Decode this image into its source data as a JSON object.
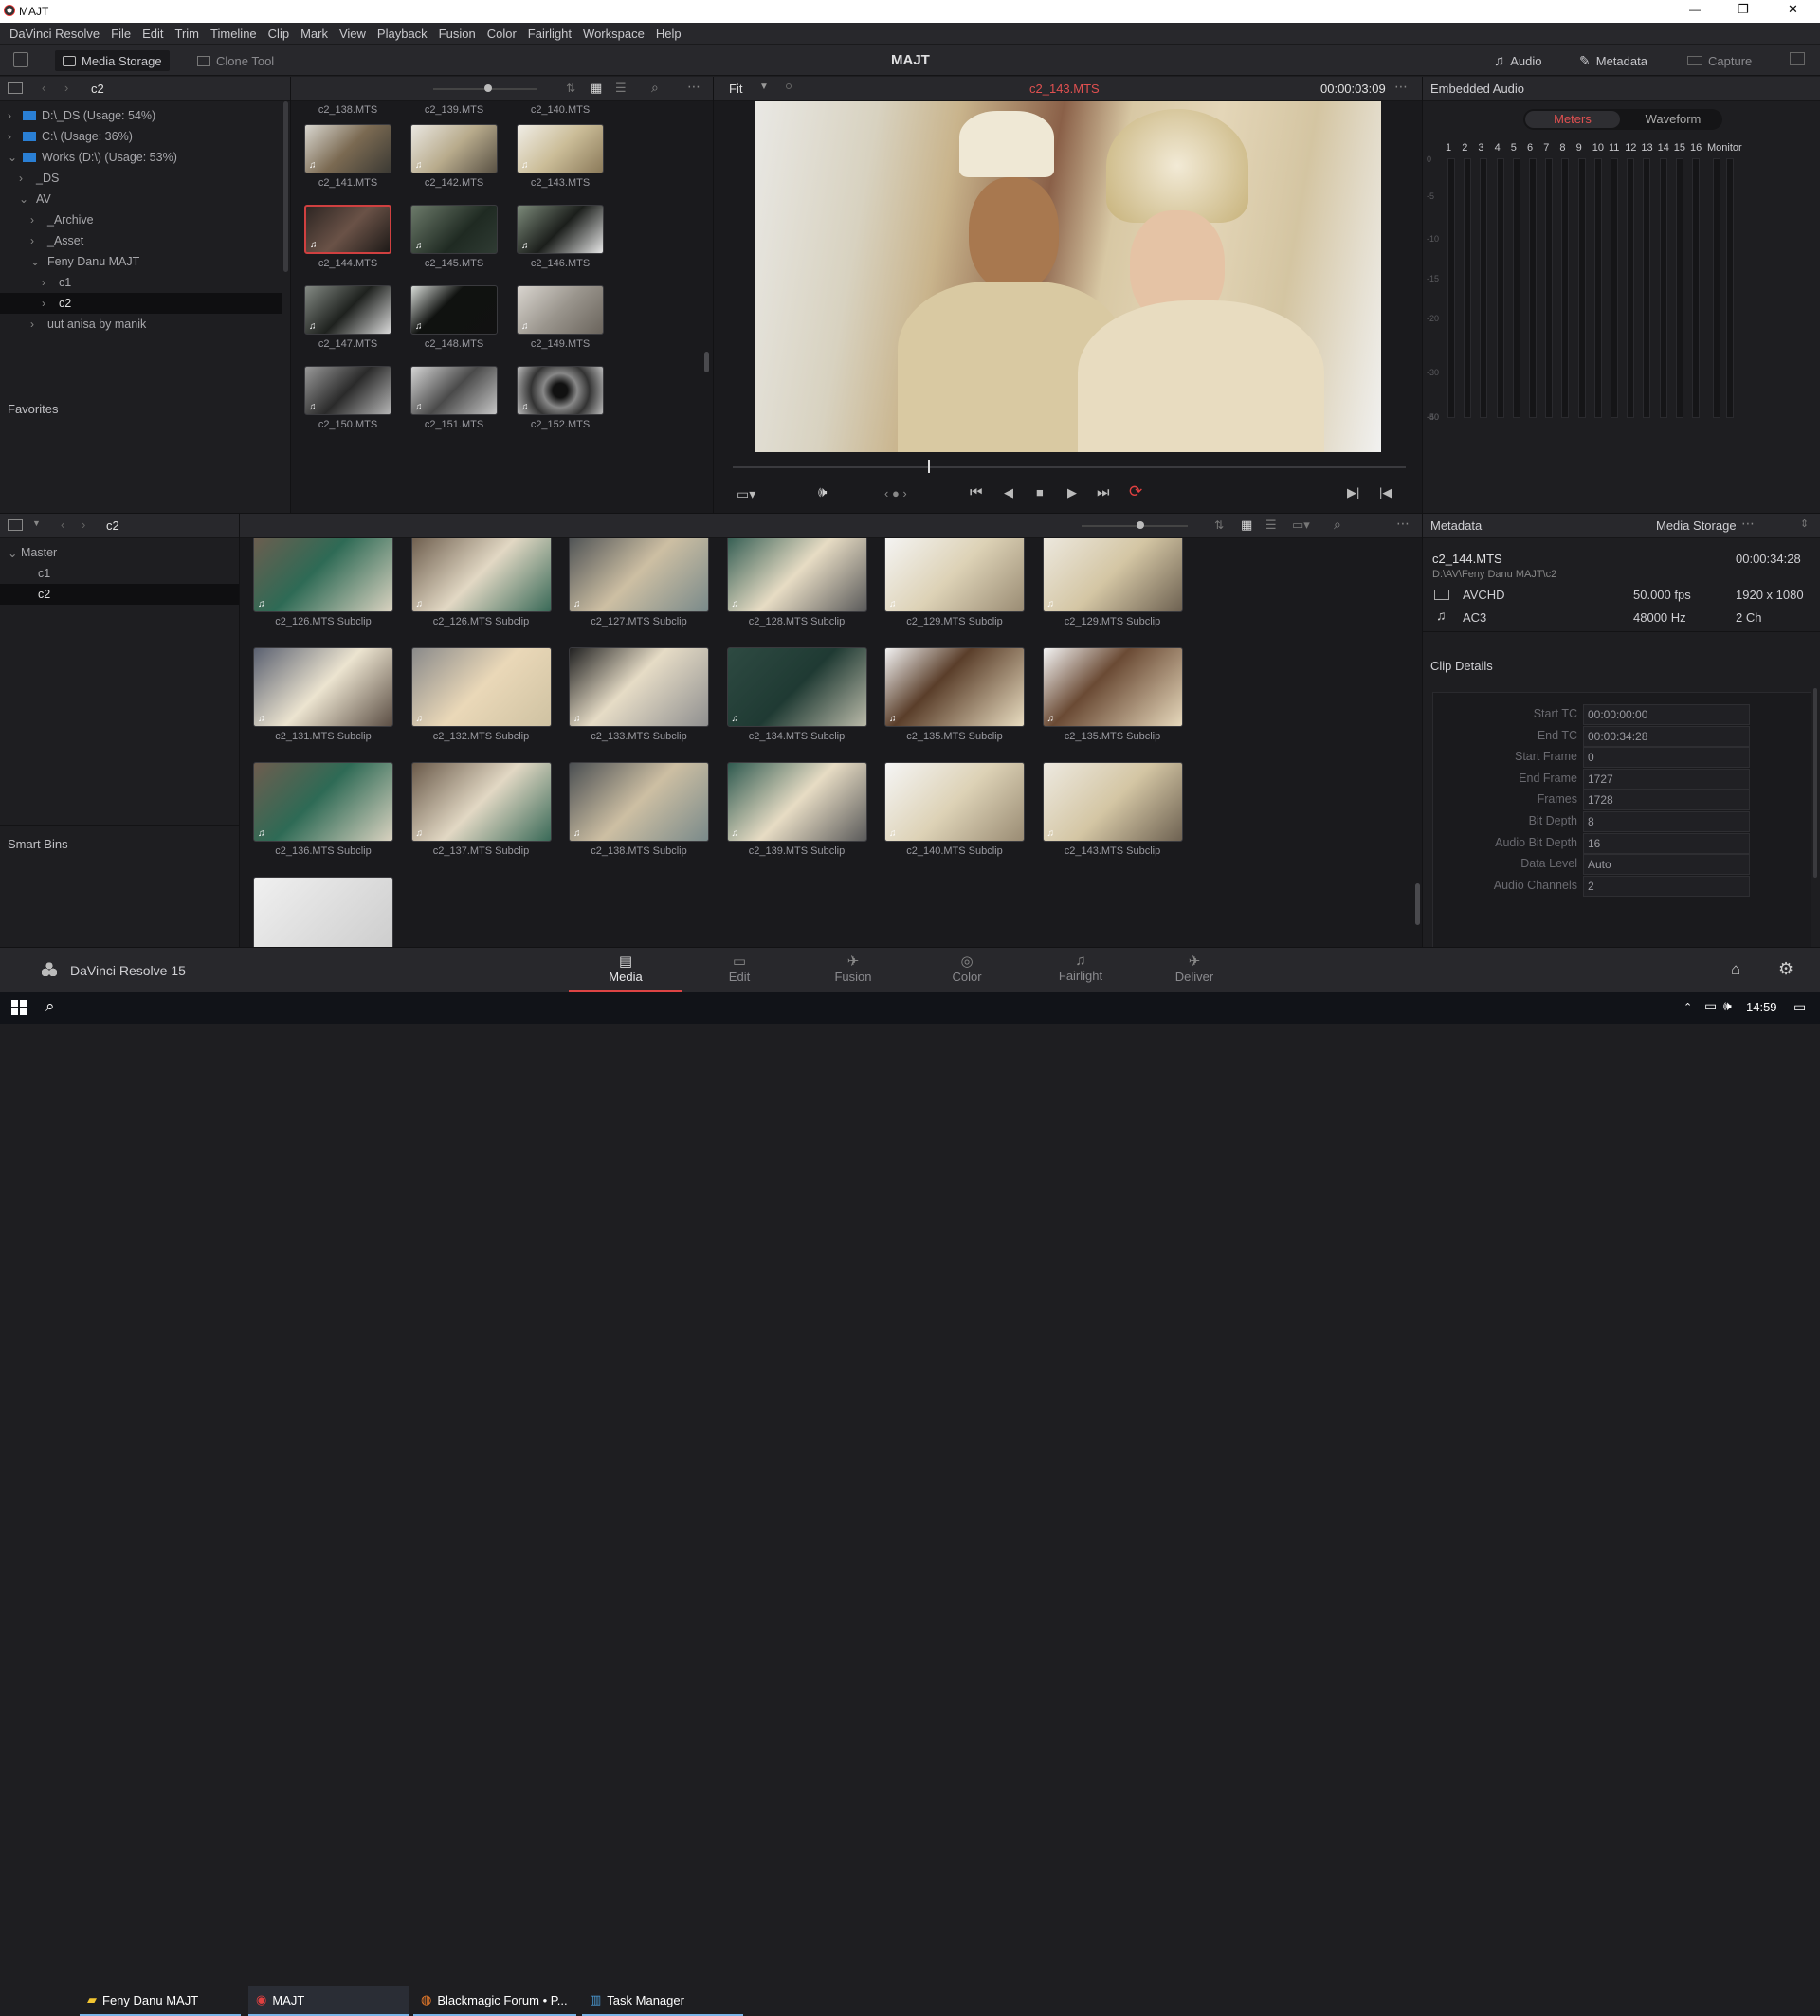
{
  "window": {
    "title": "MAJT",
    "min": "—",
    "max": "❐",
    "close": "✕"
  },
  "menu": [
    "DaVinci Resolve",
    "File",
    "Edit",
    "Trim",
    "Timeline",
    "Clip",
    "Mark",
    "View",
    "Playback",
    "Fusion",
    "Color",
    "Fairlight",
    "Workspace",
    "Help"
  ],
  "toolbar": {
    "media_storage": "Media Storage",
    "clone_tool": "Clone Tool",
    "project": "MAJT",
    "audio": "Audio",
    "metadata": "Metadata",
    "capture": "Capture"
  },
  "storage": {
    "path": "c2",
    "items": [
      {
        "label": "D:\\_DS (Usage: 54%)"
      },
      {
        "label": "C:\\ (Usage: 36%)"
      },
      {
        "label": "Works (D:\\) (Usage: 53%)"
      },
      {
        "label": "_DS"
      },
      {
        "label": "AV"
      },
      {
        "label": "_Archive"
      },
      {
        "label": "_Asset"
      },
      {
        "label": "Feny Danu MAJT"
      },
      {
        "label": "c1"
      },
      {
        "label": "c2"
      },
      {
        "label": "uut anisa by manik"
      }
    ],
    "favorites": "Favorites"
  },
  "storage_clips": {
    "top_row": [
      "c2_138.MTS",
      "c2_139.MTS",
      "c2_140.MTS"
    ],
    "rows": [
      [
        "c2_141.MTS",
        "c2_142.MTS",
        "c2_143.MTS"
      ],
      [
        "c2_144.MTS",
        "c2_145.MTS",
        "c2_146.MTS"
      ],
      [
        "c2_147.MTS",
        "c2_148.MTS",
        "c2_149.MTS"
      ],
      [
        "c2_150.MTS",
        "c2_151.MTS",
        "c2_152.MTS"
      ]
    ]
  },
  "viewer": {
    "zoom": "Fit",
    "clip": "c2_143.MTS",
    "timecode": "00:00:03:09",
    "playhead_fraction": 0.29
  },
  "audio": {
    "title": "Embedded Audio",
    "tab_meters": "Meters",
    "tab_waveform": "Waveform",
    "channels": [
      "1",
      "2",
      "3",
      "4",
      "5",
      "6",
      "7",
      "8",
      "9",
      "10",
      "11",
      "12",
      "13",
      "14",
      "15",
      "16"
    ],
    "monitor": "Monitor",
    "db": [
      "0",
      "-5",
      "-10",
      "-15",
      "-20",
      "-30",
      "-40",
      "-50"
    ]
  },
  "pool": {
    "path": "c2",
    "bins": [
      {
        "label": "Master"
      },
      {
        "label": "c1"
      },
      {
        "label": "c2"
      }
    ],
    "smart_bins": "Smart Bins",
    "clips": [
      [
        "c2_126.MTS Subclip",
        "c2_126.MTS Subclip",
        "c2_127.MTS Subclip",
        "c2_128.MTS Subclip",
        "c2_129.MTS Subclip",
        "c2_129.MTS Subclip"
      ],
      [
        "c2_131.MTS Subclip",
        "c2_132.MTS Subclip",
        "c2_133.MTS Subclip",
        "c2_134.MTS Subclip",
        "c2_135.MTS Subclip",
        "c2_135.MTS Subclip"
      ],
      [
        "c2_136.MTS Subclip",
        "c2_137.MTS Subclip",
        "c2_138.MTS Subclip",
        "c2_139.MTS Subclip",
        "c2_140.MTS Subclip",
        "c2_143.MTS Subclip"
      ]
    ]
  },
  "metadata": {
    "title": "Metadata",
    "source": "Media Storage",
    "clip": "c2_144.MTS",
    "duration": "00:00:34:28",
    "path": "D:\\AV\\Feny Danu MAJT\\c2",
    "video_codec": "AVCHD",
    "fps": "50.000 fps",
    "resolution": "1920 x 1080",
    "audio_codec": "AC3",
    "sample_rate": "48000 Hz",
    "channels": "2 Ch",
    "details_title": "Clip Details",
    "fields": [
      {
        "label": "Start TC",
        "value": "00:00:00:00"
      },
      {
        "label": "End TC",
        "value": "00:00:34:28"
      },
      {
        "label": "Start Frame",
        "value": "0"
      },
      {
        "label": "End Frame",
        "value": "1727"
      },
      {
        "label": "Frames",
        "value": "1728"
      },
      {
        "label": "Bit Depth",
        "value": "8"
      },
      {
        "label": "Audio Bit Depth",
        "value": "16"
      },
      {
        "label": "Data Level",
        "value": "Auto"
      },
      {
        "label": "Audio Channels",
        "value": "2"
      }
    ]
  },
  "pages": {
    "app": "DaVinci Resolve 15",
    "tabs": [
      "Media",
      "Edit",
      "Fusion",
      "Color",
      "Fairlight",
      "Deliver"
    ],
    "active": "Media"
  },
  "taskbar": {
    "items": [
      "Feny Danu MAJT",
      "MAJT",
      "Blackmagic Forum • P...",
      "Task Manager"
    ],
    "time": "14:59"
  },
  "colors": {
    "accent": "#d04040",
    "timecode_red": "#e05050",
    "bg": "#1e1e21",
    "header": "#28282c"
  }
}
